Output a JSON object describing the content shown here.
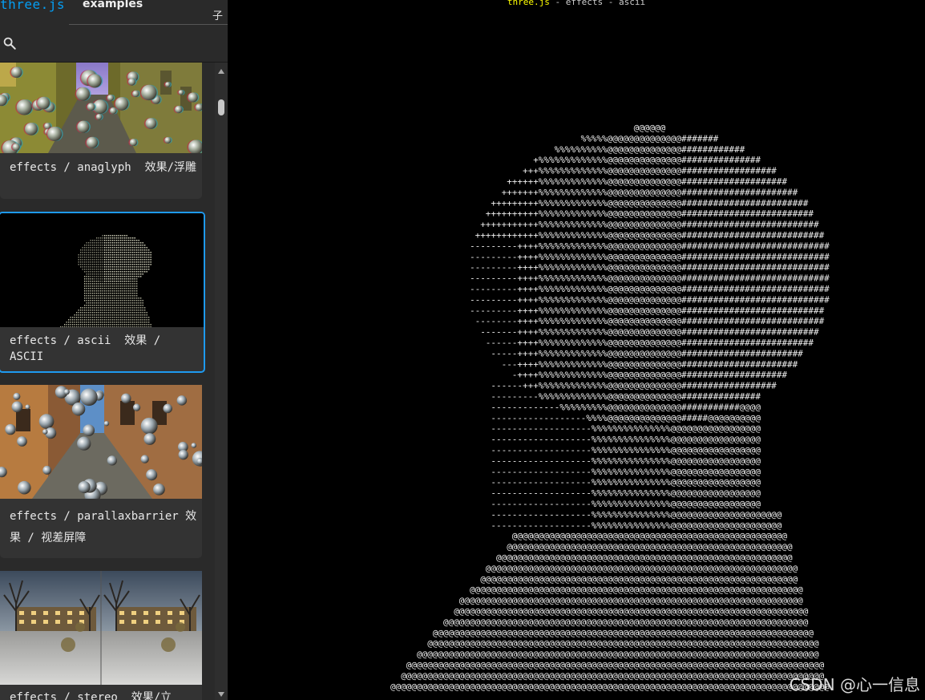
{
  "sidebar": {
    "brand": "three.js",
    "tab": "examples",
    "lang_toggle": "子",
    "search_placeholder": "",
    "cards": [
      {
        "label": "effects / anaglyph  效果/浮雕",
        "thumb": "anaglyph"
      },
      {
        "label": "effects / ascii  效果 / ASCII",
        "thumb": "ascii"
      },
      {
        "label": "effects / parallaxbarrier 效果 / 视差屏障",
        "thumb": "parallax"
      },
      {
        "label": "effects / stereo  效果/立",
        "thumb": "stereo"
      }
    ]
  },
  "viewport": {
    "info_link": "three.js",
    "info_rest": " - effects - ascii",
    "watermark": "CSDN @心一信息"
  },
  "colors": {
    "accent": "#049ef4",
    "selected_border": "#1e9af0",
    "info_link": "#ffff00"
  }
}
